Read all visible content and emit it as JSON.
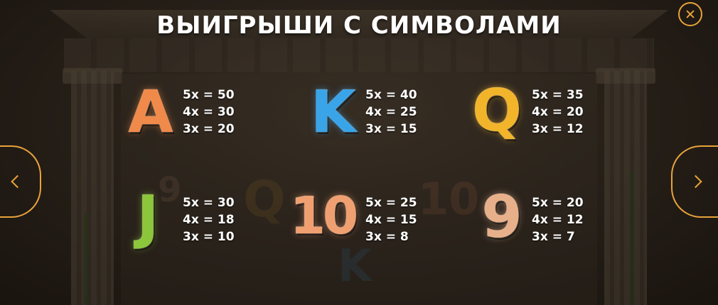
{
  "title": "ВЫИГРЫШИ С СИМВОЛАМИ",
  "controls": {
    "close_icon": "close-icon",
    "prev_icon": "chevron-left-icon",
    "next_icon": "chevron-right-icon",
    "accent_color": "#e8a33a"
  },
  "symbols": [
    {
      "glyph": "A",
      "color": "#f08a4a",
      "payouts": [
        "5x = 50",
        "4x = 30",
        "3x = 20"
      ]
    },
    {
      "glyph": "K",
      "color": "#3aa4e8",
      "payouts": [
        "5x = 40",
        "4x = 25",
        "3x = 15"
      ]
    },
    {
      "glyph": "Q",
      "color": "#f2b42a",
      "payouts": [
        "5x = 35",
        "4x = 20",
        "3x = 12"
      ]
    },
    {
      "glyph": "J",
      "color": "#8cc63a",
      "payouts": [
        "5x = 30",
        "4x = 18",
        "3x = 10"
      ]
    },
    {
      "glyph": "10",
      "color": "#f0a070",
      "payouts": [
        "5x = 25",
        "4x = 15",
        "3x = 8"
      ]
    },
    {
      "glyph": "9",
      "color": "#e8b08a",
      "payouts": [
        "5x = 20",
        "4x = 12",
        "3x = 7"
      ]
    }
  ]
}
